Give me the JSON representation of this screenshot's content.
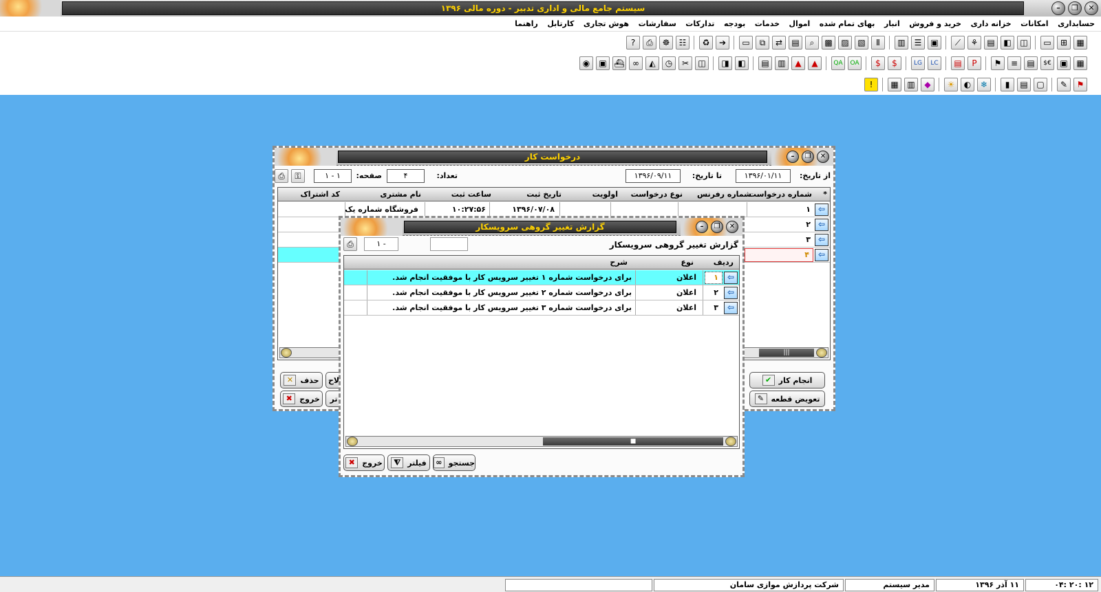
{
  "app": {
    "title": "سیستم جامع مالی و اداری تدبیر - دوره مالی ۱۳۹۶"
  },
  "menu": [
    "حسابداری",
    "امکانات",
    "خزانه داری",
    "خرید و فروش",
    "انبار",
    "بهای تمام شده",
    "اموال",
    "خدمات",
    "بودجه",
    "تدارکات",
    "سفارشات",
    "هوش تجاری",
    "کارتابل",
    "راهنما"
  ],
  "toolbar1": [
    "grid-icon",
    "chart-icon",
    "card-icon",
    "stack-icon",
    "bag-icon",
    "table-icon",
    "tree-icon",
    "chart-line-icon",
    "door-icon",
    "list-icon",
    "report-icon",
    "search-icon",
    "folder-icon",
    "network-icon",
    "forward-icon",
    "link-icon",
    "tool-icon",
    "users-icon",
    "print-icon",
    "help-icon"
  ],
  "toolbar2": [
    "calc-icon",
    "image-icon",
    "dollar-euro-icon",
    "money-icon",
    "equalizer-icon",
    "flag-icon",
    "pdf-icon",
    "doc-icon",
    "lc-icon",
    "lg-icon",
    "dollar-icon",
    "oa-icon",
    "qa-icon",
    "alert-icon",
    "warning-icon",
    "book-icon",
    "ledger-icon",
    "truck-icon",
    "bus-icon",
    "open-book-icon",
    "scissors-icon",
    "clock-icon",
    "car-icon",
    "binoculars-icon",
    "ship-icon",
    "atm-icon",
    "globe-icon"
  ],
  "toolbar3": [
    "flag-color-icon",
    "pencil-icon",
    "box-icon",
    "clipboard-icon",
    "bar-chart-icon",
    "snowflake-icon",
    "moon-icon",
    "sun-icon",
    "paint-icon",
    "columns-icon",
    "registry-icon",
    "warning-circle-icon"
  ],
  "work_request": {
    "title": "درخواست کار",
    "from_date_label": "از تاریخ:",
    "from_date": "۱۳۹۶/۰۱/۱۱",
    "to_date_label": "تا تاریخ:",
    "to_date": "۱۳۹۶/۰۹/۱۱",
    "count_label": "تعداد:",
    "count": "۴",
    "page_label": "صفحه:",
    "page": "۱ - ۱",
    "columns": [
      "شماره درخواست",
      "شماره رفرنس",
      "نوع درخواست",
      "اولویت",
      "تاریخ ثبت",
      "ساعت ثبت",
      "نام مشتری",
      "کد اشتراک"
    ],
    "rows": [
      {
        "num": "۱",
        "date": "۱۳۹۶/۰۷/۰۸",
        "time": "۱۰:۲۷:۵۶",
        "customer": "فروشگاه شماره یک"
      },
      {
        "num": "۲",
        "date": "",
        "time": "",
        "customer": ""
      },
      {
        "num": "۳",
        "date": "",
        "time": "",
        "customer": ""
      },
      {
        "num": "۴",
        "date": "",
        "time": "",
        "customer": ""
      }
    ],
    "buttons": {
      "do_work": "انجام کار",
      "replace_part": "تعویض قطعه",
      "delete": "حذف",
      "exit": "خروج",
      "partial_left_top": "لاح",
      "partial_left_bottom": "تر"
    }
  },
  "report": {
    "title": "گزارش تغییر گروهی سرویسکار",
    "header_label": "گزارش تغییر گروهی سرویسکار",
    "page": "۱ - ",
    "columns": [
      "ردیف",
      "نوع",
      "شرح"
    ],
    "rows": [
      {
        "num": "۱",
        "type": "اعلان",
        "desc": "برای درخواست شماره ۱ تغییر سرویس کار با موفقیت انجام شد."
      },
      {
        "num": "۲",
        "type": "اعلان",
        "desc": "برای درخواست شماره ۲ تغییر سرویس کار با موفقیت انجام شد."
      },
      {
        "num": "۳",
        "type": "اعلان",
        "desc": "برای درخواست شماره ۳ تغییر سرویس کار با موفقیت انجام شد."
      }
    ],
    "buttons": {
      "search": "جستجو",
      "filter": "فیلتر",
      "exit": "خروج"
    }
  },
  "status": {
    "time": "۱۲ :۲۰ :۰۴",
    "date": "۱۱ آذر ۱۳۹۶",
    "user": "مدیر سیستم",
    "company": "شرکت پردازش موازی سامان"
  },
  "colors": {
    "desktop": "#5aaeee",
    "title_text": "#ffd200",
    "selected_row": "#66ffff"
  }
}
